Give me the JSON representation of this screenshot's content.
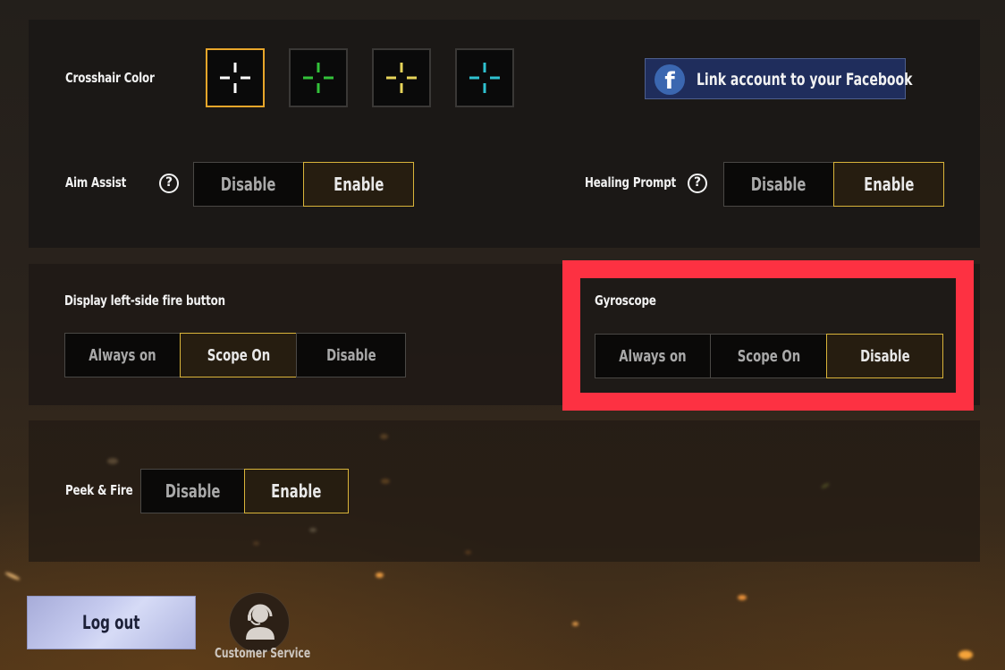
{
  "crosshair": {
    "label": "Crosshair Color",
    "options": [
      {
        "name": "white",
        "color": "#ffffff",
        "selected": true
      },
      {
        "name": "green",
        "color": "#33c23a",
        "selected": false
      },
      {
        "name": "yellow",
        "color": "#e7d45a",
        "selected": false
      },
      {
        "name": "cyan",
        "color": "#2fc2d0",
        "selected": false
      }
    ]
  },
  "facebook": {
    "icon": "facebook-icon",
    "glyph": "f",
    "label": "Link account to your Facebook"
  },
  "aim_assist": {
    "label": "Aim Assist",
    "help_glyph": "?",
    "options": [
      "Disable",
      "Enable"
    ],
    "selected": "Enable"
  },
  "healing_prompt": {
    "label": "Healing Prompt",
    "help_glyph": "?",
    "options": [
      "Disable",
      "Enable"
    ],
    "selected": "Enable"
  },
  "left_fire_button": {
    "label": "Display left-side fire button",
    "options": [
      "Always on",
      "Scope On",
      "Disable"
    ],
    "selected": "Scope On"
  },
  "gyroscope": {
    "label": "Gyroscope",
    "options": [
      "Always on",
      "Scope On",
      "Disable"
    ],
    "selected": "Disable",
    "highlight_color": "#fd3142"
  },
  "peek_fire": {
    "label": "Peek & Fire",
    "options": [
      "Disable",
      "Enable"
    ],
    "selected": "Enable"
  },
  "footer": {
    "logout_label": "Log out",
    "customer_service_label": "Customer Service",
    "customer_service_icon": "headset-support-icon"
  },
  "colors": {
    "selected_border": "#d9b43a",
    "swatch_selected_border": "#e8a62a",
    "facebook_bg": "#1f2d5c"
  }
}
